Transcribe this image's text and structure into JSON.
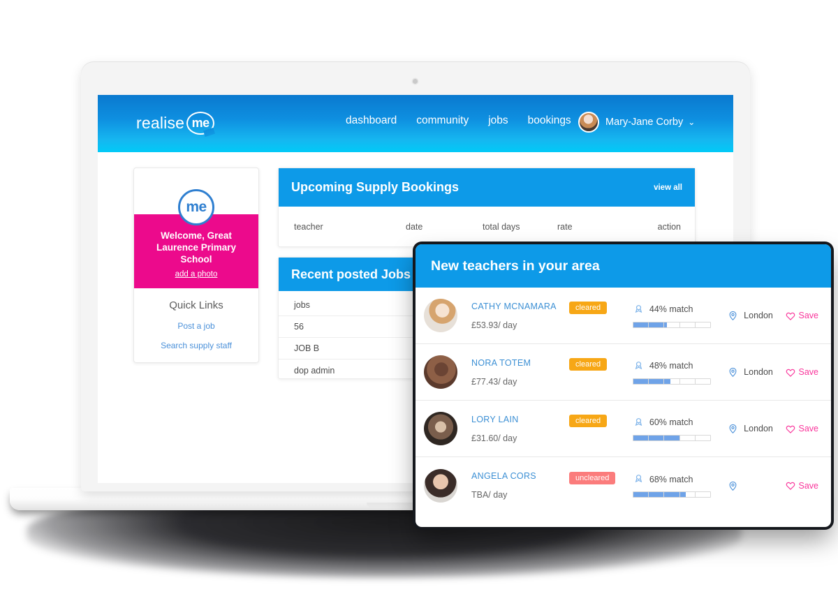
{
  "brand": {
    "name": "realise",
    "mark": "me",
    "accent": "#0d9ae8",
    "pink": "#ec0a8c"
  },
  "nav": {
    "links": [
      {
        "label": "dashboard"
      },
      {
        "label": "community"
      },
      {
        "label": "jobs"
      },
      {
        "label": "bookings"
      }
    ],
    "user": {
      "name": "Mary-Jane Corby",
      "caret": "⌄",
      "avatar_icon": "user-avatar"
    }
  },
  "profile": {
    "logo_text": "me",
    "welcome": "Welcome, Great Laurence Primary School",
    "add_photo": "add a photo",
    "quick_links_title": "Quick Links",
    "links": [
      {
        "label": "Post a job"
      },
      {
        "label": "Search supply staff"
      }
    ]
  },
  "bookings": {
    "title": "Upcoming Supply Bookings",
    "view_all": "view all",
    "columns": [
      "teacher",
      "date",
      "total days",
      "rate",
      "action"
    ]
  },
  "jobs": {
    "title": "Recent posted Jobs",
    "rows": [
      "jobs",
      "56",
      "JOB B",
      "dop admin"
    ]
  },
  "teachers": {
    "title": "New teachers in your area",
    "save_label": "Save",
    "rows": [
      {
        "name": "CATHY MCNAMARA",
        "rate": "£53.93/ day",
        "status": "cleared",
        "status_color": "#f7a716",
        "match_text": "44% match",
        "match_value": 44,
        "location": "London"
      },
      {
        "name": "NORA TOTEM",
        "rate": "£77.43/ day",
        "status": "cleared",
        "status_color": "#f7a716",
        "match_text": "48% match",
        "match_value": 48,
        "location": "London"
      },
      {
        "name": "LORY LAIN",
        "rate": "£31.60/ day",
        "status": "cleared",
        "status_color": "#f7a716",
        "match_text": "60% match",
        "match_value": 60,
        "location": "London"
      },
      {
        "name": "ANGELA CORS",
        "rate": "TBA/ day",
        "status": "uncleared",
        "status_color": "#fb7c7c",
        "match_text": "68% match",
        "match_value": 68,
        "location": ""
      }
    ]
  }
}
